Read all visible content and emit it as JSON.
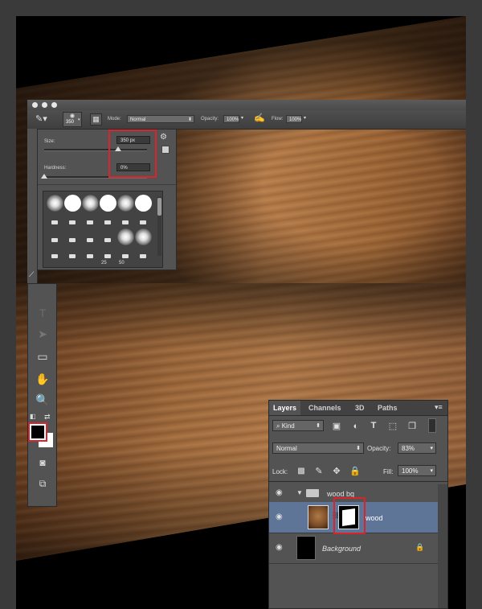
{
  "options_bar": {
    "brush_size_value": "350",
    "mode_label": "Mode:",
    "mode_value": "Normal",
    "opacity_label": "Opacity:",
    "opacity_value": "100%",
    "flow_label": "Flow:",
    "flow_value": "100%"
  },
  "brush_picker": {
    "size_label": "Size:",
    "size_value": "350 px",
    "hardness_label": "Hardness:",
    "hardness_value": "0%",
    "size_level_fraction": 0.72,
    "hardness_level_fraction": 0.0,
    "preset_numbers": [
      "25",
      "50"
    ]
  },
  "tools": [
    "text-tool",
    "path-selection-tool",
    "rectangle-tool",
    "hand-tool",
    "zoom-tool",
    "default-colors",
    "swap-colors",
    "quick-mask",
    "screen-mode"
  ],
  "colors": {
    "foreground": "#000000",
    "background": "#ffffff",
    "highlight_red": "#d8242b",
    "selected_layer": "#5f7598"
  },
  "layers_panel": {
    "tabs": [
      "Layers",
      "Channels",
      "3D",
      "Paths"
    ],
    "active_tab": "Layers",
    "filter_label": "Kind",
    "blend_mode": "Normal",
    "opacity_label": "Opacity:",
    "opacity_value": "83%",
    "lock_label": "Lock:",
    "fill_label": "Fill:",
    "fill_value": "100%",
    "layers": [
      {
        "name": "wood bg",
        "type": "group",
        "selected": false
      },
      {
        "name": "wood",
        "type": "layer-with-mask",
        "selected": true
      },
      {
        "name": "Background",
        "type": "background",
        "locked": true,
        "selected": false
      }
    ]
  }
}
